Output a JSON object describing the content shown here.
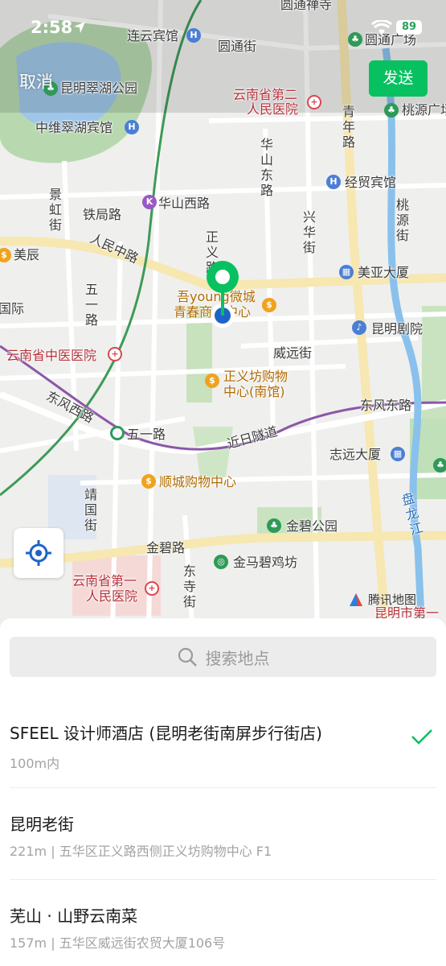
{
  "status_bar": {
    "time": "2:58",
    "battery": "89"
  },
  "header": {
    "cancel_label": "取消",
    "send_label": "发送"
  },
  "map": {
    "attribution": "腾讯地图",
    "labels": {
      "lianyun_hotel": "连云宾馆",
      "yuantong_street": "圆通街",
      "yuantong_temple": "圆通禅寺",
      "yuantong_plaza": "圆通广场",
      "cuihu_park": "昆明翠湖公园",
      "zhongwei_hotel": "中维翠湖宾馆",
      "yunnan_second_hospital_1": "云南省第二",
      "yunnan_second_hospital_2": "人民医院",
      "qingnian_road": "青年路",
      "taoyuan": "桃源广场",
      "huashan_east": "华山东路",
      "jingmao_hotel": "经贸宾馆",
      "taoyuan_street": "桃源街",
      "jinghong_street": "景虹街",
      "huashan_west": "华山西路",
      "tieju_road": "铁局路",
      "xinghua_street": "兴华街",
      "meichen": "美辰",
      "renmin_middle": "人民中路",
      "zhengyi_road": "正义路",
      "meiya_tower": "美亚大厦",
      "wuyi_road_v": "五一路",
      "guoji": "国际",
      "wuyoung_1": "吾young微城",
      "wuyoung_2": "青春商业中心",
      "kunming_theater": "昆明剧院",
      "weiyuan_street": "威远街",
      "tcm_hospital": "云南省中医医院",
      "zhengyifang_1": "正义坊购物",
      "zhengyifang_2": "中心(南馆)",
      "dongfeng_west": "东风西路",
      "dongfeng_east": "东风东路",
      "wuyi_road": "五一路",
      "jinri_tunnel": "近日隧道",
      "zhiyuan_tower": "志远大厦",
      "shunchen_mall": "顺城购物中心",
      "jingguo_street": "靖国街",
      "panlong_river": "盘龙江",
      "jinbi_park": "金碧公园",
      "jinbi_road": "金碧路",
      "jinma_biji": "金马碧鸡坊",
      "dongsi_street": "东寺街",
      "first_hospital_1": "云南省第一",
      "first_hospital_2": "人民医院",
      "kunming_city_first": "昆明市第一"
    }
  },
  "search": {
    "placeholder": "搜索地点"
  },
  "results": [
    {
      "name": "SFEEL 设计师酒店 (昆明老街南屏步行街店)",
      "detail": "100m内",
      "selected": true
    },
    {
      "name": "昆明老街",
      "detail": "221m | 五华区正义路西侧正义坊购物中心 F1",
      "selected": false
    },
    {
      "name": "芜山 · 山野云南菜",
      "detail": "157m | 五华区威远街农贸大厦106号",
      "selected": false
    }
  ],
  "colors": {
    "accent": "#07c160",
    "pin": "#07c160",
    "location_dot": "#1f63c8"
  }
}
